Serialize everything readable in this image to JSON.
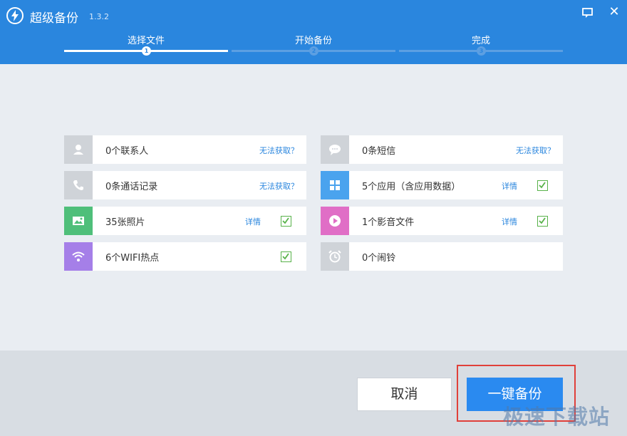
{
  "app": {
    "title": "超级备份",
    "version": "1.3.2"
  },
  "steps": [
    {
      "label": "选择文件",
      "number": "1"
    },
    {
      "label": "开始备份",
      "number": "2"
    },
    {
      "label": "完成",
      "number": "3"
    }
  ],
  "items": {
    "contacts": {
      "label": "0个联系人",
      "link": "无法获取？"
    },
    "sms": {
      "label": "0条短信",
      "link": "无法获取？"
    },
    "calls": {
      "label": "0条通话记录",
      "link": "无法获取？"
    },
    "apps": {
      "label": "5个应用（含应用数据）",
      "link": "详情",
      "checked": true
    },
    "photos": {
      "label": "35张照片",
      "link": "详情",
      "checked": true
    },
    "media": {
      "label": "1个影音文件",
      "link": "详情",
      "checked": true
    },
    "wifi": {
      "label": "6个WIFI热点",
      "checked": true
    },
    "alarms": {
      "label": "0个闹铃"
    }
  },
  "footer": {
    "cancel_label": "取消",
    "backup_label": "一键备份"
  },
  "watermark": "极速下载站",
  "colors": {
    "titlebar": "#2a86de",
    "primary_button": "#2a8af0",
    "check": "#58b24a",
    "photos_icon_bg": "#4fbf7a",
    "apps_icon_bg": "#4aa3ee",
    "media_icon_bg": "#e06ec6",
    "wifi_icon_bg": "#a57fe8",
    "inactive_icon_bg": "#cfd3d8"
  }
}
